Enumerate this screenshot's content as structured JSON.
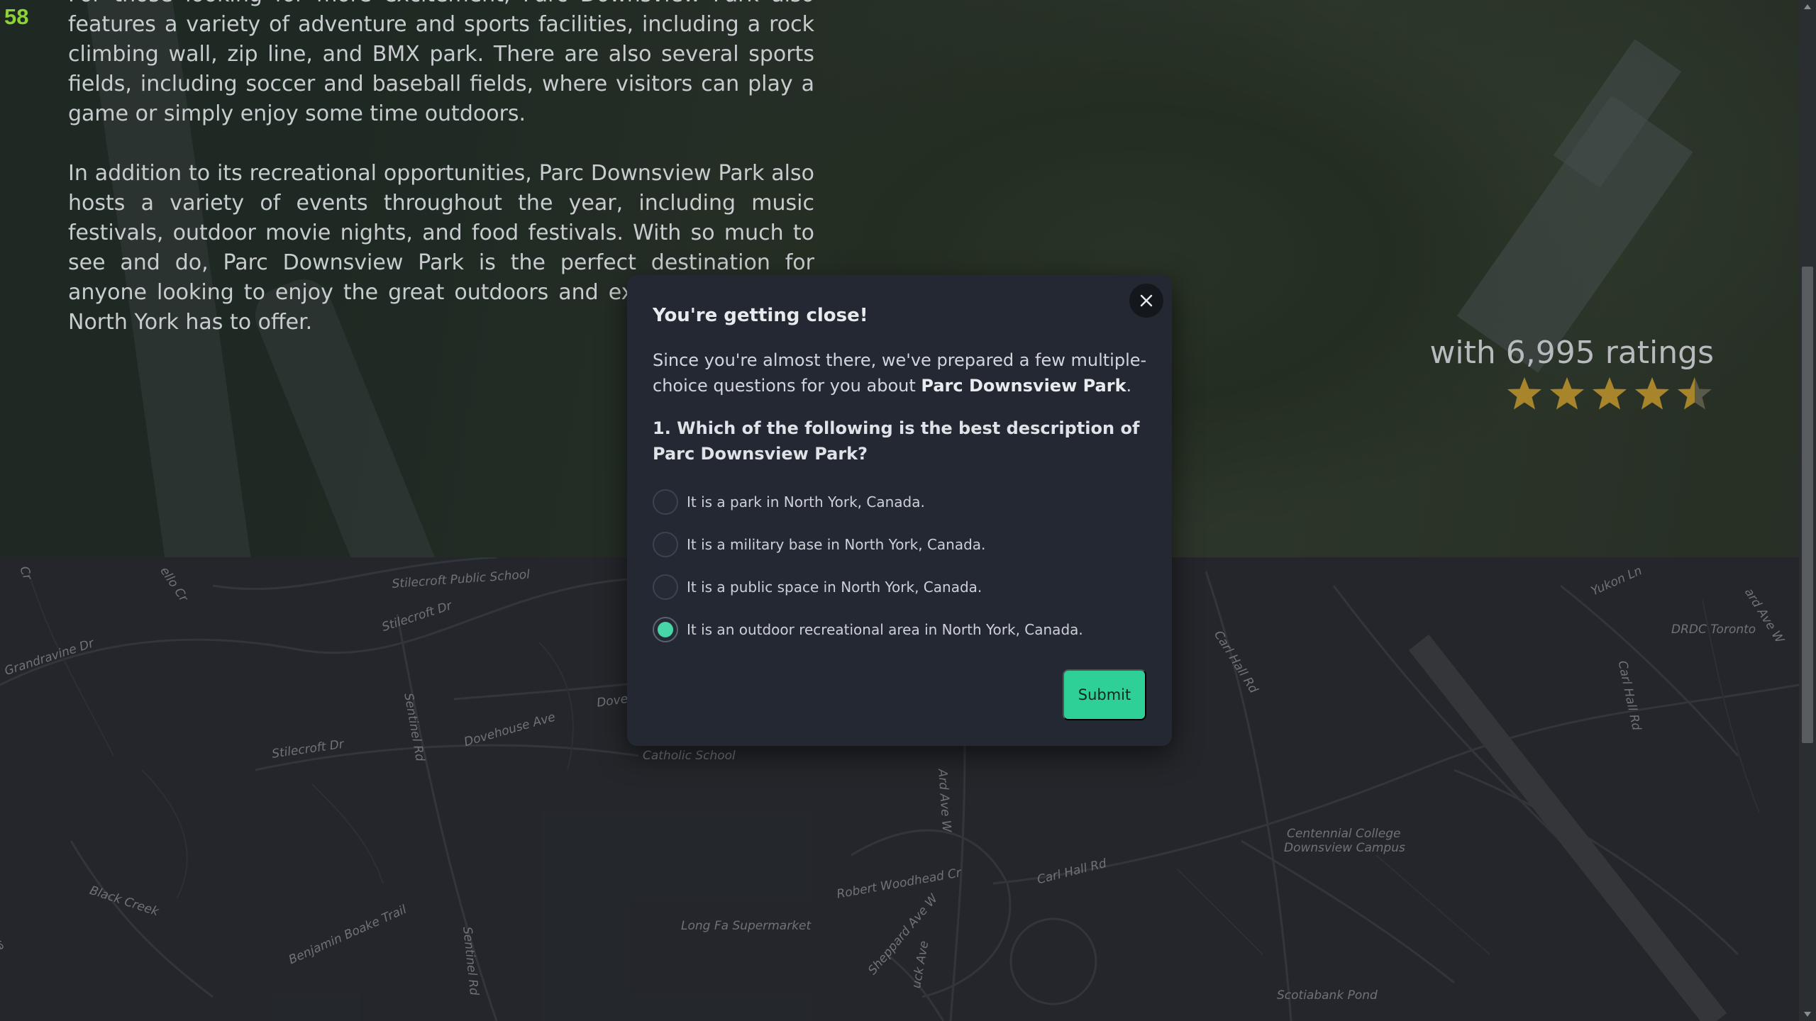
{
  "page_number": "58",
  "article": {
    "paragraph_1": "For those looking for more excitement, Parc Downsview Park also features a variety of adventure and sports facilities, including a rock climbing wall, zip line, and BMX park. There are also several sports fields, including soccer and baseball fields, where visitors can play a game or simply enjoy some time outdoors.",
    "paragraph_2": "In addition to its recreational opportunities, Parc Downsview Park also hosts a variety of events throughout the year, including music festivals, outdoor movie nights, and food festivals. With so much to see and do, Parc Downsview Park is the perfect destination for anyone looking to enjoy the great outdoors and experience all that North York has to offer."
  },
  "rating": {
    "text": "with 6,995 ratings",
    "stars_value": 4.5,
    "stars_max": 5,
    "star_color": "#a8852a"
  },
  "map_labels": [
    "Stilecroft Public School",
    "Stilecroft Dr",
    "Grandravine Dr",
    "Sentinel Rd",
    "Dovehouse Ave",
    "Dove",
    "Stilecroft Dr",
    "Catholic School",
    "Black Creek",
    "Robert Woodhead Cr",
    "Long Fa Supermarket",
    "Benjamin Boake Trail",
    "Sentinel Rd",
    "Sheppard Ave W",
    "Carl Hall Rd",
    "Carl Hall Rd",
    "Centennial College",
    "Downsview Campus",
    "Scotiabank Pond",
    "Yukon Ln",
    "DRDC Toronto",
    "Carl Hall Rd",
    "Ard Ave W",
    "ard Ave W",
    "Cr",
    "ello Cr",
    "Ave",
    "uck Ave"
  ],
  "modal": {
    "title": "You're getting close!",
    "intro_prefix": "Since you're almost there, we've prepared a few multiple-choice questions for you about ",
    "intro_bold": "Parc Downsview Park",
    "intro_suffix": ".",
    "question": "1. Which of the following is the best description of Parc Downsview Park?",
    "options": [
      {
        "label": "It is a park in North York, Canada.",
        "checked": false
      },
      {
        "label": "It is a military base in North York, Canada.",
        "checked": false
      },
      {
        "label": "It is a public space in North York, Canada.",
        "checked": false
      },
      {
        "label": "It is an outdoor recreational area in North York, Canada.",
        "checked": true
      }
    ],
    "submit_label": "Submit",
    "accent_color": "#2fcf98",
    "close_icon": "close-icon"
  }
}
